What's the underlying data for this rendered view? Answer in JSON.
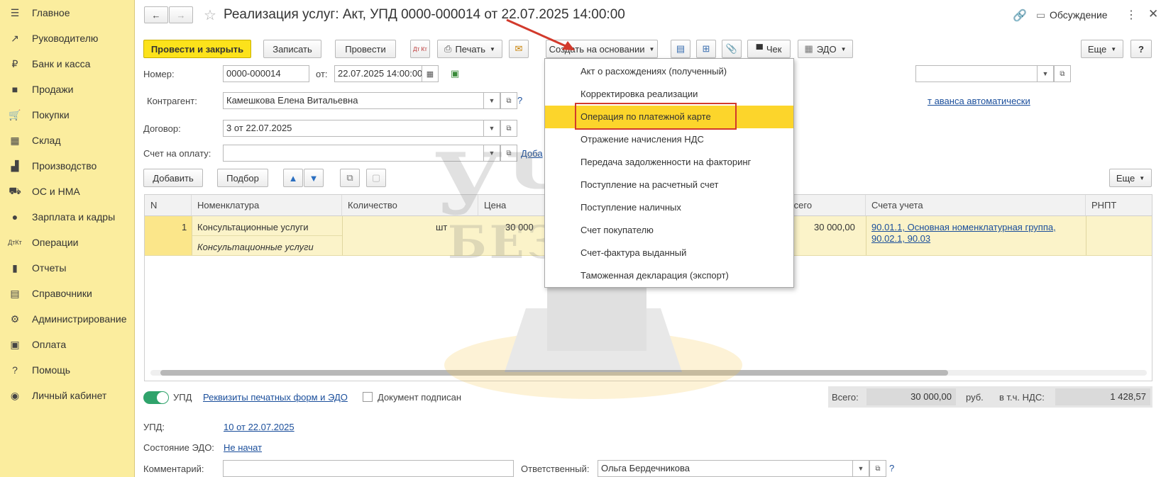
{
  "sidebar": {
    "items": [
      {
        "label": "Главное",
        "icon": "menu-icon"
      },
      {
        "label": "Руководителю",
        "icon": "trend-icon"
      },
      {
        "label": "Банк и касса",
        "icon": "ruble-icon"
      },
      {
        "label": "Продажи",
        "icon": "bag-icon"
      },
      {
        "label": "Покупки",
        "icon": "cart-icon"
      },
      {
        "label": "Склад",
        "icon": "warehouse-icon"
      },
      {
        "label": "Производство",
        "icon": "factory-icon"
      },
      {
        "label": "ОС и НМА",
        "icon": "truck-icon"
      },
      {
        "label": "Зарплата и кадры",
        "icon": "person-icon"
      },
      {
        "label": "Операции",
        "icon": "dt-kt-icon"
      },
      {
        "label": "Отчеты",
        "icon": "bar-chart-icon"
      },
      {
        "label": "Справочники",
        "icon": "books-icon"
      },
      {
        "label": "Администрирование",
        "icon": "gear-icon"
      },
      {
        "label": "Оплата",
        "icon": "wallet-icon"
      },
      {
        "label": "Помощь",
        "icon": "question-icon"
      },
      {
        "label": "Личный кабинет",
        "icon": "account-icon"
      }
    ]
  },
  "header": {
    "title": "Реализация услуг: Акт, УПД 0000-000014 от 22.07.2025 14:00:00",
    "discussion": "Обсуждение"
  },
  "toolbar": {
    "post_close": "Провести и закрыть",
    "save": "Записать",
    "post": "Провести",
    "dtkt": "Дт Кт",
    "print": "Печать",
    "create_based": "Создать на основании",
    "check": "Чек",
    "edo": "ЭДО",
    "more": "Еще",
    "help": "?"
  },
  "form": {
    "number_label": "Номер:",
    "number_value": "0000-000014",
    "date_label": "от:",
    "date_value": "22.07.2025 14:00:00",
    "contractor_label": "Контрагент:",
    "contractor_value": "Камешкова Елена Витальевна",
    "contract_label": "Договор:",
    "contract_value": "3 от 22.07.2025",
    "invoice_label": "Счет на оплату:",
    "invoice_value": "",
    "add_link_partial": "Доба",
    "advance_link_partial": "т аванса автоматически",
    "help_q": "?"
  },
  "table_toolbar": {
    "add": "Добавить",
    "pick": "Подбор",
    "more": "Еще"
  },
  "table": {
    "columns": [
      "N",
      "Номенклатура",
      "Количество",
      "Цена",
      "Всего",
      "Счета учета",
      "РНПТ"
    ],
    "row": {
      "n": "1",
      "name": "Консультационные услуги",
      "name_sub": "Консультационные услуги",
      "unit": "шт",
      "price_partial": "30 000",
      "total": "30 000,00",
      "accounts": "90.01.1, Основная номенклатурная группа, 90.02.1, 90.03"
    }
  },
  "menu": {
    "items": [
      "Акт о расхождениях (полученный)",
      "Корректировка реализации",
      "Операция по платежной карте",
      "Отражение начисления НДС",
      "Передача задолженности на факторинг",
      "Поступление на расчетный счет",
      "Поступление наличных",
      "Счет покупателю",
      "Счет-фактура выданный",
      "Таможенная декларация (экспорт)"
    ],
    "highlighted_index": 2
  },
  "footer": {
    "upd_toggle": "УПД",
    "requisites_link": "Реквизиты печатных форм и ЭДО",
    "signed_label": "Документ подписан",
    "total_label": "Всего:",
    "total_value": "30 000,00",
    "currency": "руб.",
    "vat_label": "в т.ч. НДС:",
    "vat_value": "1 428,57",
    "upd_label": "УПД:",
    "upd_link": "10 от 22.07.2025",
    "edo_state_label": "Состояние ЭДО:",
    "edo_state_link": "Не начат",
    "comment_label": "Комментарий:",
    "responsible_label": "Ответственный:",
    "responsible_value": "Ольга Бердечникова"
  },
  "watermark": {
    "line1": "УЧЁТ",
    "line2": "БЕЗ ЗАБОТ"
  },
  "colors": {
    "sidebar_bg": "#fbed9e",
    "primary_button": "#fce21b",
    "menu_highlight": "#fcd52b",
    "highlight_box": "#d23a2c",
    "link": "#1a4e9b"
  }
}
